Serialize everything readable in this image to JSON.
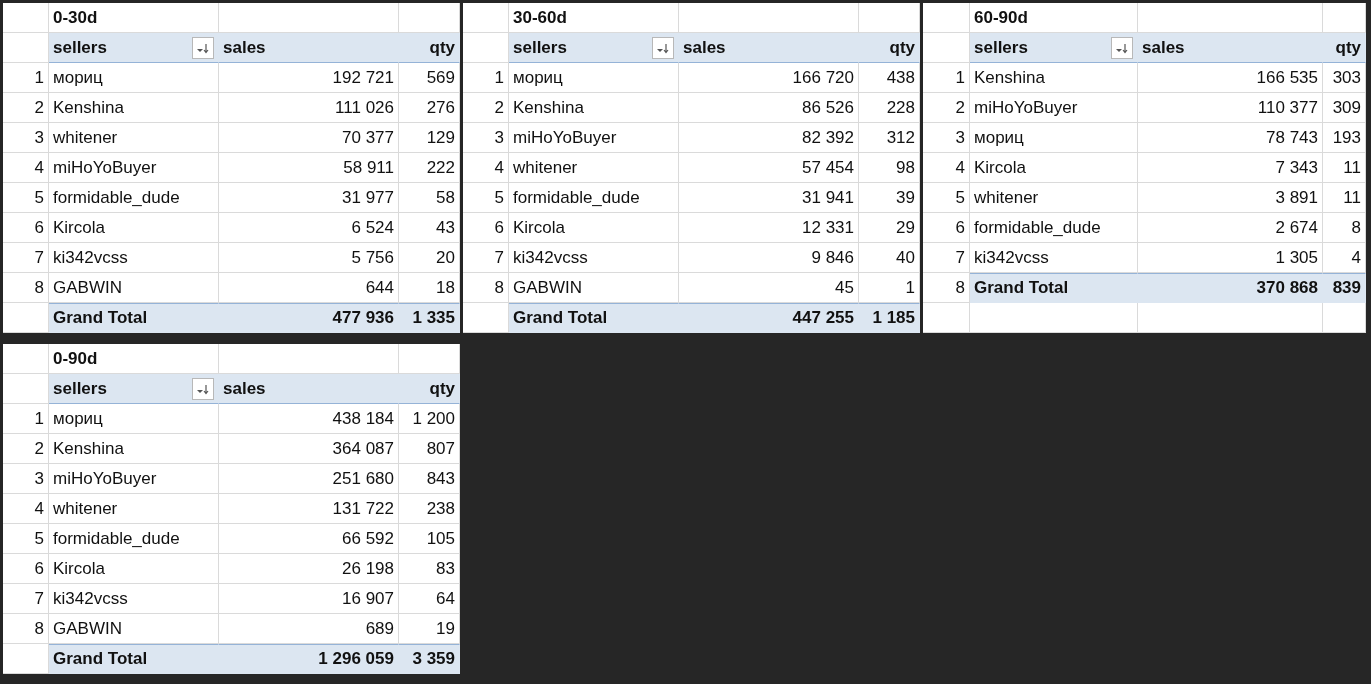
{
  "pivots": [
    {
      "title": "0-30d",
      "columns": [
        "sellers",
        "sales",
        "qty"
      ],
      "rows": [
        {
          "num": "1",
          "seller": "мориц",
          "sales": "192 721",
          "qty": "569"
        },
        {
          "num": "2",
          "seller": "Kenshina",
          "sales": "111 026",
          "qty": "276"
        },
        {
          "num": "3",
          "seller": "whitener",
          "sales": "70 377",
          "qty": "129"
        },
        {
          "num": "4",
          "seller": "miHoYoBuyer",
          "sales": "58 911",
          "qty": "222"
        },
        {
          "num": "5",
          "seller": "formidable_dude",
          "sales": "31 977",
          "qty": "58"
        },
        {
          "num": "6",
          "seller": "Kircola",
          "sales": "6 524",
          "qty": "43"
        },
        {
          "num": "7",
          "seller": "ki342vcss",
          "sales": "5 756",
          "qty": "20"
        },
        {
          "num": "8",
          "seller": "GABWIN",
          "sales": "644",
          "qty": "18"
        }
      ],
      "total": {
        "label": "Grand Total",
        "sales": "477 936",
        "qty": "1 335"
      }
    },
    {
      "title": "30-60d",
      "columns": [
        "sellers",
        "sales",
        "qty"
      ],
      "rows": [
        {
          "num": "1",
          "seller": "мориц",
          "sales": "166 720",
          "qty": "438"
        },
        {
          "num": "2",
          "seller": "Kenshina",
          "sales": "86 526",
          "qty": "228"
        },
        {
          "num": "3",
          "seller": "miHoYoBuyer",
          "sales": "82 392",
          "qty": "312"
        },
        {
          "num": "4",
          "seller": "whitener",
          "sales": "57 454",
          "qty": "98"
        },
        {
          "num": "5",
          "seller": "formidable_dude",
          "sales": "31 941",
          "qty": "39"
        },
        {
          "num": "6",
          "seller": "Kircola",
          "sales": "12 331",
          "qty": "29"
        },
        {
          "num": "7",
          "seller": "ki342vcss",
          "sales": "9 846",
          "qty": "40"
        },
        {
          "num": "8",
          "seller": "GABWIN",
          "sales": "45",
          "qty": "1"
        }
      ],
      "total": {
        "label": "Grand Total",
        "sales": "447 255",
        "qty": "1 185"
      }
    },
    {
      "title": "60-90d",
      "columns": [
        "sellers",
        "sales",
        "qty"
      ],
      "rows": [
        {
          "num": "1",
          "seller": "Kenshina",
          "sales": "166 535",
          "qty": "303"
        },
        {
          "num": "2",
          "seller": "miHoYoBuyer",
          "sales": "110 377",
          "qty": "309"
        },
        {
          "num": "3",
          "seller": "мориц",
          "sales": "78 743",
          "qty": "193"
        },
        {
          "num": "4",
          "seller": "Kircola",
          "sales": "7 343",
          "qty": "11"
        },
        {
          "num": "5",
          "seller": "whitener",
          "sales": "3 891",
          "qty": "11"
        },
        {
          "num": "6",
          "seller": "formidable_dude",
          "sales": "2 674",
          "qty": "8"
        },
        {
          "num": "7",
          "seller": "ki342vcss",
          "sales": "1 305",
          "qty": "4"
        }
      ],
      "total": {
        "num": "8",
        "label": "Grand Total",
        "sales": "370 868",
        "qty": "839"
      }
    },
    {
      "title": "0-90d",
      "columns": [
        "sellers",
        "sales",
        "qty"
      ],
      "rows": [
        {
          "num": "1",
          "seller": "мориц",
          "sales": "438 184",
          "qty": "1 200"
        },
        {
          "num": "2",
          "seller": "Kenshina",
          "sales": "364 087",
          "qty": "807"
        },
        {
          "num": "3",
          "seller": "miHoYoBuyer",
          "sales": "251 680",
          "qty": "843"
        },
        {
          "num": "4",
          "seller": "whitener",
          "sales": "131 722",
          "qty": "238"
        },
        {
          "num": "5",
          "seller": "formidable_dude",
          "sales": "66 592",
          "qty": "105"
        },
        {
          "num": "6",
          "seller": "Kircola",
          "sales": "26 198",
          "qty": "83"
        },
        {
          "num": "7",
          "seller": "ki342vcss",
          "sales": "16 907",
          "qty": "64"
        },
        {
          "num": "8",
          "seller": "GABWIN",
          "sales": "689",
          "qty": "19"
        }
      ],
      "total": {
        "label": "Grand Total",
        "sales": "1 296 059",
        "qty": "3 359"
      }
    }
  ]
}
